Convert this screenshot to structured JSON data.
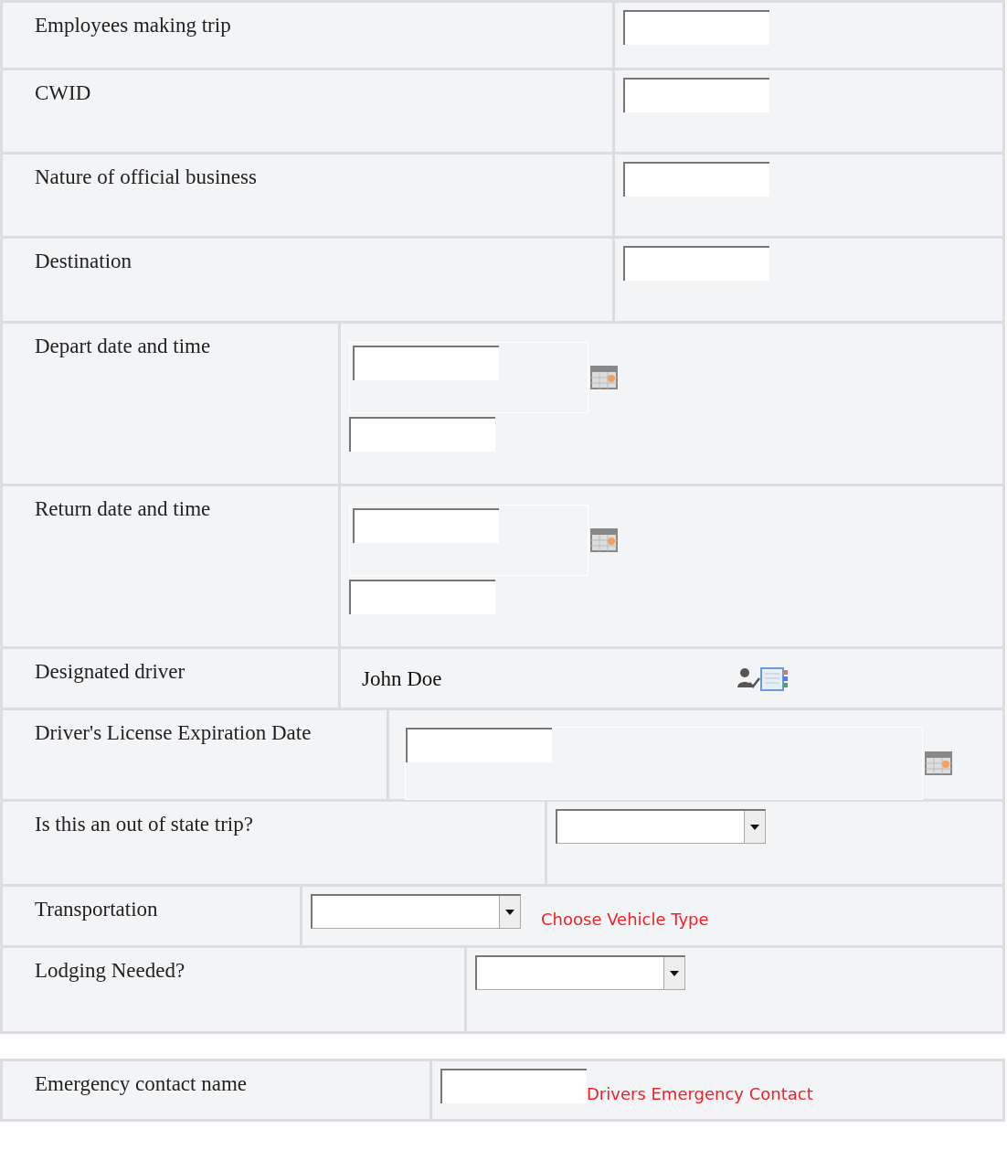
{
  "sections": [
    {
      "rows": [
        {
          "label": "Employees making trip",
          "kind": "text"
        },
        {
          "label": "CWID",
          "kind": "text"
        },
        {
          "label": "Nature of official business",
          "kind": "text"
        },
        {
          "label": "Destination",
          "kind": "text"
        },
        {
          "label": "Depart date and time",
          "kind": "datetime"
        },
        {
          "label": "Return date and time",
          "kind": "datetime"
        },
        {
          "label": "Designated driver",
          "kind": "driver",
          "value": "John Doe"
        },
        {
          "label": "Driver's License Expiration Date",
          "kind": "date"
        },
        {
          "label": "Is this an out of state trip?",
          "kind": "select"
        },
        {
          "label": "Transportation",
          "kind": "select",
          "hint": "Choose Vehicle Type"
        },
        {
          "label": "Lodging Needed?",
          "kind": "select"
        }
      ]
    },
    {
      "rows": [
        {
          "label": "Emergency contact name",
          "kind": "text",
          "hint": "Drivers Emergency Contact"
        }
      ]
    }
  ]
}
